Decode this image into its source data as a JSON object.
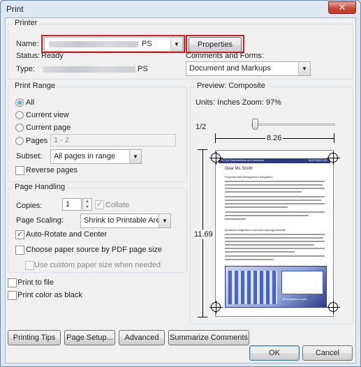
{
  "window": {
    "title": "Print",
    "close_glyph": "✕"
  },
  "printer": {
    "group_title": "Printer",
    "name_label": "Name:",
    "name_value": "PS",
    "status_label": "Status:",
    "status_value": "Ready",
    "type_label": "Type:",
    "type_value": "PS",
    "properties_label": "Properties",
    "comments_label": "Comments and Forms:",
    "comments_value": "Document and Markups"
  },
  "print_range": {
    "group_title": "Print Range",
    "all_label": "All",
    "current_view_label": "Current view",
    "current_page_label": "Current page",
    "pages_label": "Pages",
    "pages_value": "1 - 2",
    "subset_label": "Subset:",
    "subset_value": "All pages in range",
    "reverse_label": "Reverse pages"
  },
  "page_handling": {
    "group_title": "Page Handling",
    "copies_label": "Copies:",
    "copies_value": "1",
    "collate_label": "Collate",
    "scaling_label": "Page Scaling:",
    "scaling_value": "Shrink to Printable Area",
    "auto_rotate_label": "Auto-Rotate and Center",
    "choose_source_label": "Choose paper source by PDF page size",
    "custom_paper_label": "Use custom paper size when needed"
  },
  "options": {
    "print_to_file_label": "Print to file",
    "print_color_black_label": "Print color as black"
  },
  "preview": {
    "group_title": "Preview: Composite",
    "units_zoom": "Units: Inches Zoom:  97%",
    "page_indicator": "1/2",
    "width": "8.26",
    "height": "11.69",
    "slider_position": 0.0
  },
  "document_preview": {
    "header_left": "To Our Shareholders and Investors",
    "header_right": "MUSTARD.IDX",
    "greeting": "Dear Ms.Smith",
    "heading1": "Progress with Management Integration",
    "heading2": "Business Integration Costs and Synergy Benefits",
    "footer": "BI Integration costs"
  },
  "buttons": {
    "printing_tips": "Printing Tips",
    "page_setup": "Page Setup...",
    "advanced": "Advanced",
    "summarize": "Summarize Comments",
    "ok": "OK",
    "cancel": "Cancel"
  }
}
